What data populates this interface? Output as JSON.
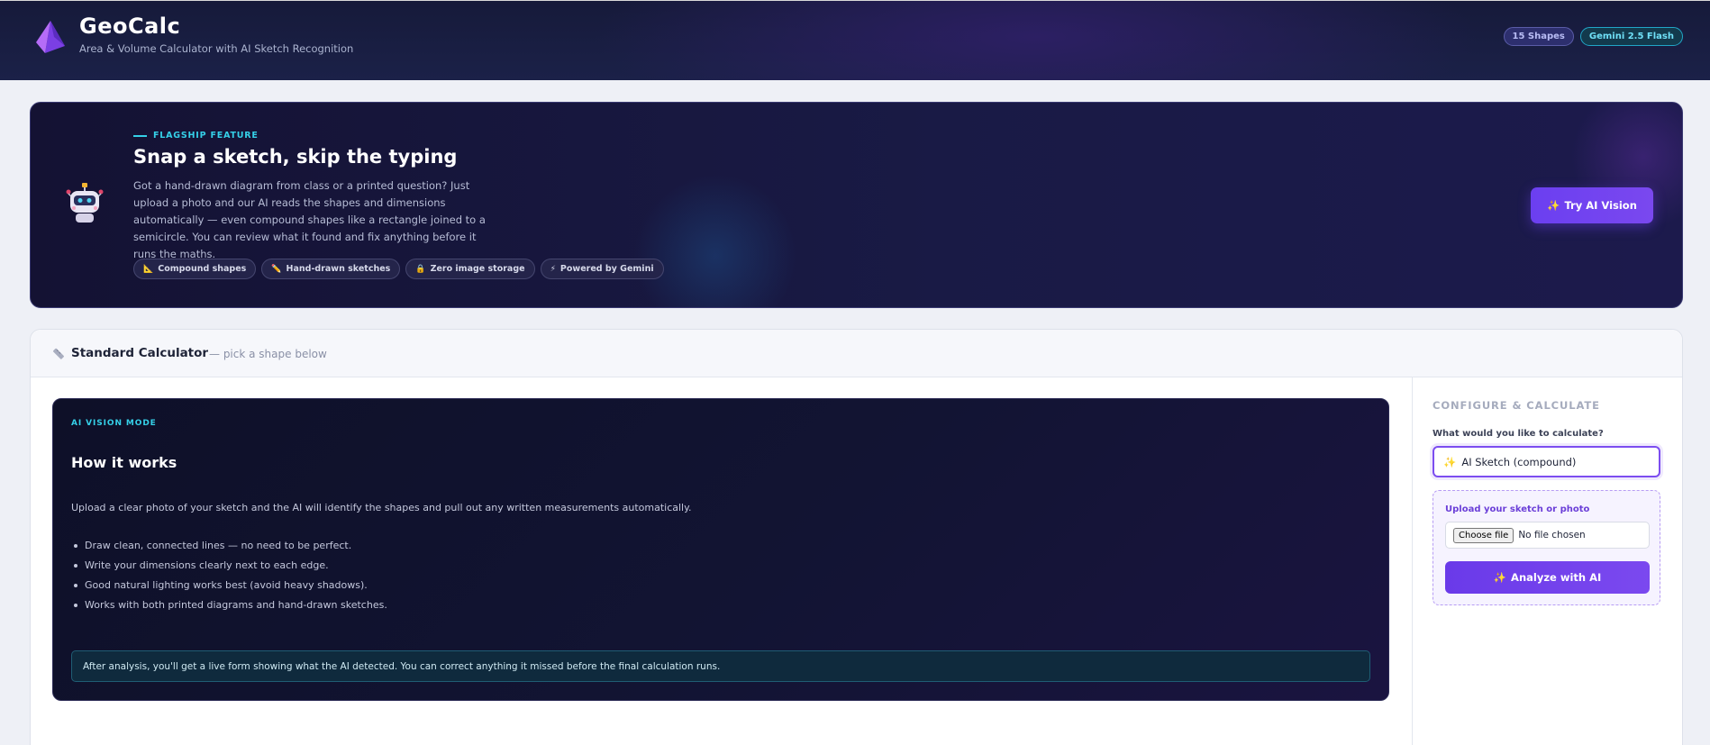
{
  "header": {
    "title": "GeoCalc",
    "subtitle": "Area & Volume Calculator with AI Sketch Recognition",
    "badges": [
      "15 Shapes",
      "Gemini 2.5 Flash"
    ]
  },
  "hero": {
    "kicker": "FLAGSHIP FEATURE",
    "title": "Snap a sketch, skip the typing",
    "description": "Got a hand-drawn diagram from class or a printed question? Just upload a photo and our AI reads the shapes and dimensions automatically — even compound shapes like a rectangle joined to a semicircle. You can review what it found and fix anything before it runs the maths.",
    "chips": [
      {
        "icon": "📐",
        "label": "Compound shapes"
      },
      {
        "icon": "✏️",
        "label": "Hand-drawn sketches"
      },
      {
        "icon": "🔒",
        "label": "Zero image storage"
      },
      {
        "icon": "⚡",
        "label": "Powered by Gemini"
      }
    ],
    "cta_icon": "✨",
    "cta_label": "Try AI Vision"
  },
  "calculator": {
    "title": "Standard Calculator",
    "hint": "— pick a shape below",
    "ai_panel": {
      "mode_label": "AI VISION MODE",
      "heading": "How it works",
      "intro": "Upload a clear photo of your sketch and the AI will identify the shapes and pull out any written measurements automatically.",
      "tips": [
        "Draw clean, connected lines — no need to be perfect.",
        "Write your dimensions clearly next to each edge.",
        "Good natural lighting works best (avoid heavy shadows).",
        "Works with both printed diagrams and hand-drawn sketches."
      ],
      "note": "After analysis, you'll get a live form showing what the AI detected. You can correct anything it missed before the final calculation runs."
    },
    "config": {
      "heading": "CONFIGURE & CALCULATE",
      "question": "What would you like to calculate?",
      "selected_icon": "✨",
      "selected": "AI Sketch (compound)",
      "upload_label": "Upload your sketch or photo",
      "file_button": "Choose file",
      "file_status": "No file chosen",
      "analyze_icon": "✨",
      "analyze_label": "Analyze with AI"
    }
  },
  "colors": {
    "accent": "#7c4df0",
    "cyan": "#35d0e8",
    "header_bg": "#161a3a"
  }
}
